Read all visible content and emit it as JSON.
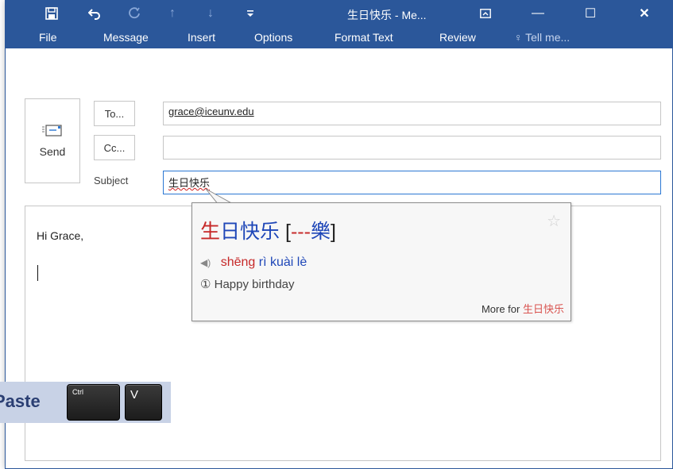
{
  "window": {
    "title": "生日快乐 - Me...",
    "colors": {
      "accent": "#2b579a",
      "focus": "#2b77d3",
      "chinese_red": "#c62828",
      "chinese_blue": "#1f47b8"
    }
  },
  "quick_access": {
    "save_icon": "save-icon",
    "undo_icon": "undo-icon",
    "redo_icon": "redo-icon",
    "up_icon": "arrow-up-icon",
    "down_icon": "arrow-down-icon",
    "customize_icon": "customize-qat-icon"
  },
  "window_controls": {
    "ribbon_display_icon": "ribbon-display-options-icon",
    "minimize_glyph": "—",
    "maximize_glyph": "☐",
    "close_glyph": "✕"
  },
  "ribbon_tabs": [
    "File",
    "Message",
    "Insert",
    "Options",
    "Format Text",
    "Review",
    "Tell me..."
  ],
  "header": {
    "send_label": "Send",
    "to_button": "To...",
    "cc_button": "Cc...",
    "subject_label": "Subject",
    "to_value": "grace@iceunv.edu",
    "cc_value": "",
    "subject_value": "生日快乐"
  },
  "body": {
    "greeting": "Hi Grace,"
  },
  "popup": {
    "headword_first": "生",
    "headword_rest": "日快乐",
    "traditional_open": "[",
    "traditional_dashes": "---",
    "traditional_char": "樂",
    "traditional_close": "]",
    "pinyin": [
      {
        "syllable": "shēng",
        "tone_color": "red"
      },
      {
        "syllable": "rì",
        "tone_color": "blue"
      },
      {
        "syllable": "kuài",
        "tone_color": "blue"
      },
      {
        "syllable": "lè",
        "tone_color": "blue"
      }
    ],
    "definition_marker": "①",
    "definition": "Happy birthday",
    "more_prefix": "More for",
    "more_link": "生日快乐"
  },
  "paste_hint": {
    "label": "Paste",
    "ctrl_key": "Ctrl",
    "v_key": "V"
  }
}
